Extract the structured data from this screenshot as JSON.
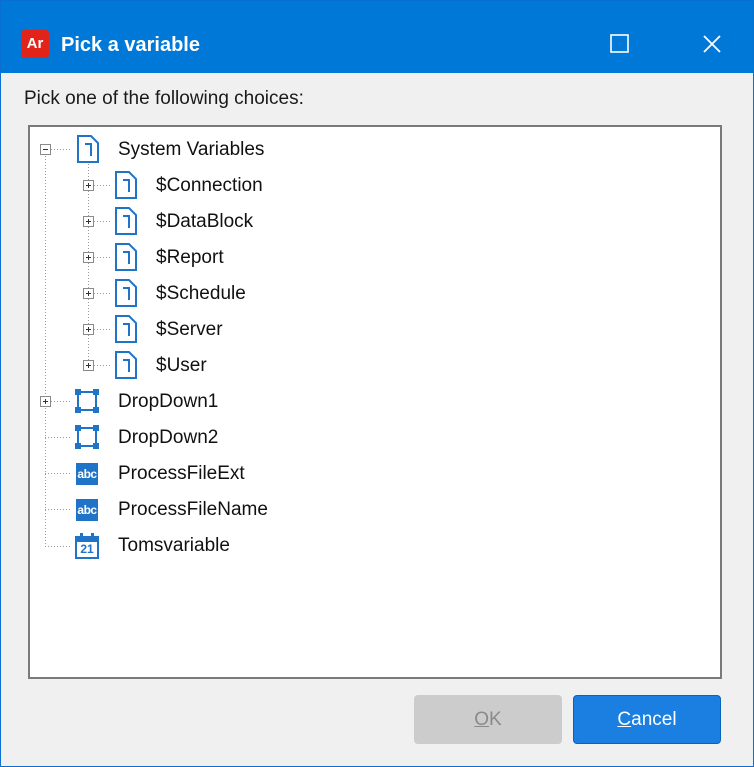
{
  "window": {
    "title": "Pick a variable",
    "app_icon_text": "Ar",
    "prompt": "Pick one of the following choices:"
  },
  "tree": {
    "root": {
      "label": "System Variables",
      "icon": "document-icon",
      "expanded": true
    },
    "system_children": [
      {
        "label": "$Connection",
        "icon": "document-icon"
      },
      {
        "label": "$DataBlock",
        "icon": "document-icon"
      },
      {
        "label": "$Report",
        "icon": "document-icon"
      },
      {
        "label": "$Schedule",
        "icon": "document-icon"
      },
      {
        "label": "$Server",
        "icon": "document-icon"
      },
      {
        "label": "$User",
        "icon": "document-icon"
      }
    ],
    "top_level": [
      {
        "label": "DropDown1",
        "icon": "dropdown-icon",
        "expandable": true
      },
      {
        "label": "DropDown2",
        "icon": "dropdown-icon",
        "expandable": false
      },
      {
        "label": "ProcessFileExt",
        "icon": "text-variable-icon",
        "icon_text": "abc"
      },
      {
        "label": "ProcessFileName",
        "icon": "text-variable-icon",
        "icon_text": "abc"
      },
      {
        "label": "Tomsvariable",
        "icon": "calendar-icon",
        "icon_text": "21"
      }
    ]
  },
  "buttons": {
    "ok_mnemonic": "O",
    "ok_rest": "K",
    "ok_enabled": false,
    "cancel_mnemonic": "C",
    "cancel_rest": "ancel"
  },
  "colors": {
    "titlebar": "#0078d7",
    "icon_blue": "#1f74c8",
    "cancel_button": "#1a7fe0",
    "disabled_button": "#cccccc",
    "app_icon": "#e2231a"
  }
}
